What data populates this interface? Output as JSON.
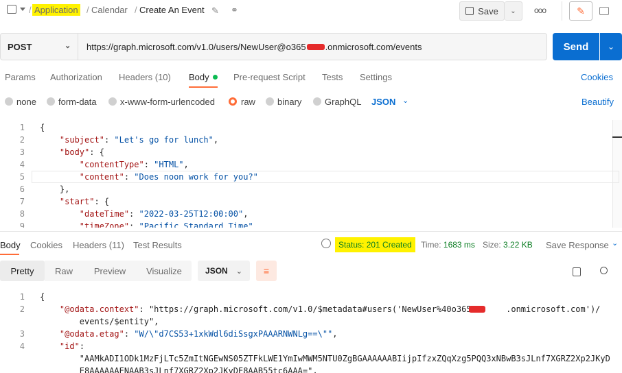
{
  "header": {
    "breadcrumb": [
      "Application",
      "Calendar",
      "Create An Event"
    ],
    "save_label": "Save",
    "more_label": "ooo"
  },
  "request": {
    "method": "POST",
    "url_prefix": "https://graph.microsoft.com/v1.0/users/NewUser@o365",
    "url_suffix": ".onmicrosoft.com/events",
    "send_label": "Send"
  },
  "tabs": [
    {
      "label": "Params"
    },
    {
      "label": "Authorization"
    },
    {
      "label": "Headers (10)"
    },
    {
      "label": "Body"
    },
    {
      "label": "Pre-request Script"
    },
    {
      "label": "Tests"
    },
    {
      "label": "Settings"
    }
  ],
  "cookies_label": "Cookies",
  "body_types": [
    "none",
    "form-data",
    "x-www-form-urlencoded",
    "raw",
    "binary",
    "GraphQL"
  ],
  "format_label": "JSON",
  "beautify_label": "Beautify",
  "request_code": [
    {
      "n": "1",
      "text": "{"
    },
    {
      "n": "2",
      "text": "    \"subject\": \"Let's go for lunch\","
    },
    {
      "n": "3",
      "text": "    \"body\": {"
    },
    {
      "n": "4",
      "text": "        \"contentType\": \"HTML\","
    },
    {
      "n": "5",
      "text": "        \"content\": \"Does noon work for you?\""
    },
    {
      "n": "6",
      "text": "    },"
    },
    {
      "n": "7",
      "text": "    \"start\": {"
    },
    {
      "n": "8",
      "text": "        \"dateTime\": \"2022-03-25T12:00:00\","
    },
    {
      "n": "9",
      "text": "        \"timeZone\": \"Pacific Standard Time\""
    }
  ],
  "response": {
    "tabs": [
      {
        "label": "Body"
      },
      {
        "label": "Cookies"
      },
      {
        "label": "Headers (11)"
      },
      {
        "label": "Test Results"
      }
    ],
    "status": "Status: 201 Created",
    "time_label": "Time:",
    "time": "1683 ms",
    "size_label": "Size:",
    "size": "3.22 KB",
    "save_response": "Save Response",
    "view_modes": [
      "Pretty",
      "Raw",
      "Preview",
      "Visualize"
    ],
    "format": "JSON",
    "code": [
      {
        "n": "1",
        "text": "{"
      },
      {
        "n": "2",
        "text": "    \"@odata.context\": \"https://graph.microsoft.com/v1.0/$metadata#users('NewUser%40o365       .onmicrosoft.com')/"
      },
      {
        "n": "",
        "text": "        events/$entity\","
      },
      {
        "n": "3",
        "text": "    \"@odata.etag\": \"W/\\\"d7CS53+1xkWdl6diSsgxPAAARNWNLg==\\\"\","
      },
      {
        "n": "4",
        "text": "    \"id\":"
      },
      {
        "n": "",
        "text": "        \"AAMkADI1ODk1MzFjLTc5ZmItNGEwNS05ZTFkLWE1YmIwMWM5NTU0ZgBGAAAAAABIijpIfzxZQqXzg5PQQ3xNBwB3sJLnf7XGRZ2Xp2JKyD"
      },
      {
        "n": "",
        "text": "        E8AAAAAAENAAB3sJLnf7XGRZ2Xp2JKyDE8AAB55tc6AAA=\","
      }
    ]
  },
  "colors": {
    "accent": "#ff6c37",
    "send": "#0a6ed1",
    "highlight": "#fff200",
    "status_ok": "#0a7d22"
  }
}
